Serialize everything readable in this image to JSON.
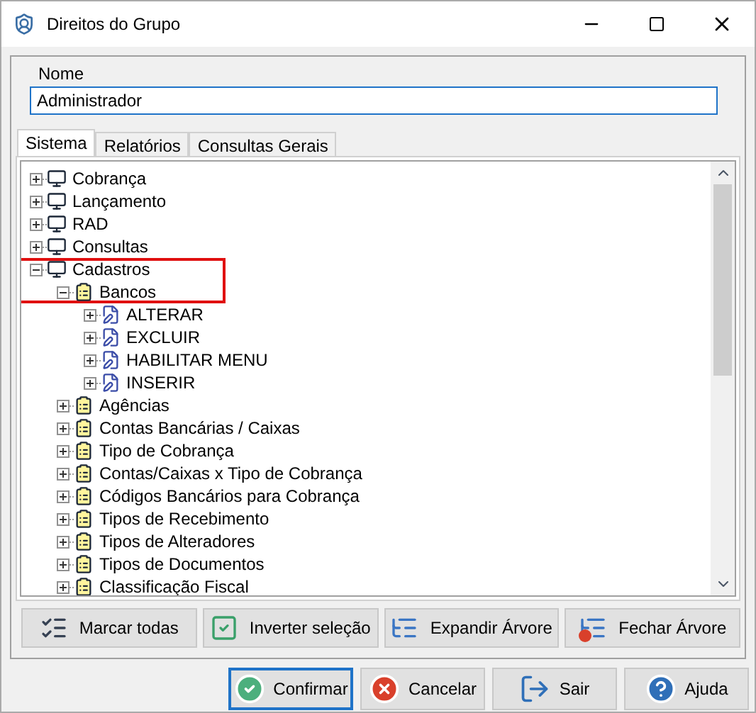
{
  "window": {
    "title": "Direitos do Grupo"
  },
  "name_field": {
    "label": "Nome",
    "value": "Administrador"
  },
  "tabs": [
    {
      "label": "Sistema",
      "selected": true
    },
    {
      "label": "Relatórios",
      "selected": false
    },
    {
      "label": "Consultas Gerais",
      "selected": false
    }
  ],
  "tree": [
    {
      "label": "Cobrança",
      "kind": "module",
      "expanded": false,
      "highlighted": false
    },
    {
      "label": "Lançamento",
      "kind": "module",
      "expanded": false,
      "highlighted": false
    },
    {
      "label": "RAD",
      "kind": "module",
      "expanded": false,
      "highlighted": false
    },
    {
      "label": "Consultas",
      "kind": "module",
      "expanded": false,
      "highlighted": false
    },
    {
      "label": "Cadastros",
      "kind": "module",
      "expanded": true,
      "highlighted": true,
      "children": [
        {
          "label": "Bancos",
          "kind": "form",
          "expanded": true,
          "children": [
            {
              "label": "ALTERAR",
              "kind": "action",
              "expanded": false
            },
            {
              "label": "EXCLUIR",
              "kind": "action",
              "expanded": false
            },
            {
              "label": "HABILITAR MENU",
              "kind": "action",
              "expanded": false
            },
            {
              "label": "INSERIR",
              "kind": "action",
              "expanded": false
            }
          ]
        },
        {
          "label": "Agências",
          "kind": "form",
          "expanded": false
        },
        {
          "label": "Contas Bancárias / Caixas",
          "kind": "form",
          "expanded": false
        },
        {
          "label": "Tipo de Cobrança",
          "kind": "form",
          "expanded": false
        },
        {
          "label": "Contas/Caixas x Tipo de Cobrança",
          "kind": "form",
          "expanded": false
        },
        {
          "label": "Códigos Bancários para Cobrança",
          "kind": "form",
          "expanded": false
        },
        {
          "label": "Tipos de Recebimento",
          "kind": "form",
          "expanded": false
        },
        {
          "label": "Tipos de Alteradores",
          "kind": "form",
          "expanded": false
        },
        {
          "label": "Tipos de Documentos",
          "kind": "form",
          "expanded": false
        },
        {
          "label": "Classificação Fiscal",
          "kind": "form",
          "expanded": false
        }
      ]
    }
  ],
  "tree_buttons": [
    {
      "label": "Marcar todas",
      "kind": "mark_all"
    },
    {
      "label": "Inverter seleção",
      "kind": "invert"
    },
    {
      "label": "Expandir Árvore",
      "kind": "expand"
    },
    {
      "label": "Fechar Árvore",
      "kind": "collapse"
    }
  ],
  "dialog_buttons": [
    {
      "label": "Confirmar",
      "kind": "confirm",
      "default": true
    },
    {
      "label": "Cancelar",
      "kind": "cancel",
      "default": false
    },
    {
      "label": "Sair",
      "kind": "exit",
      "default": false
    },
    {
      "label": "Ajuda",
      "kind": "help",
      "default": false
    }
  ]
}
